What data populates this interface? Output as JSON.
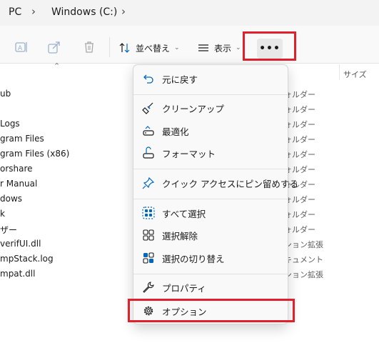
{
  "breadcrumb": {
    "items": [
      "PC",
      "Windows (C:)"
    ]
  },
  "toolbar": {
    "sort_label": "並べ替え",
    "view_label": "表示",
    "more_label": "•••"
  },
  "file_list": {
    "size_header": "サイズ",
    "rows": [
      {
        "name": "ub",
        "type": "ォルダー"
      },
      {
        "name": "",
        "type": "ォルダー"
      },
      {
        "name": "Logs",
        "type": "ォルダー"
      },
      {
        "name": "gram Files",
        "type": "ォルダー"
      },
      {
        "name": "gram Files (x86)",
        "type": "ォルダー"
      },
      {
        "name": "orshare",
        "type": "ォルダー"
      },
      {
        "name": "r Manual",
        "type": "ォルダー"
      },
      {
        "name": "dows",
        "type": "ォルダー"
      },
      {
        "name": "k",
        "type": "ォルダー"
      },
      {
        "name": "ザー",
        "type": "ォルダー"
      },
      {
        "name": "verifUI.dll",
        "type": "ション拡張"
      },
      {
        "name": "mpStack.log",
        "type": "キュメント"
      },
      {
        "name": "mpat.dll",
        "type": "ション拡張"
      }
    ]
  },
  "menu": {
    "undo": "元に戻す",
    "cleanup": "クリーンアップ",
    "optimize": "最適化",
    "format": "フォーマット",
    "pin_quick_access": "クイック アクセスにピン留めする",
    "select_all": "すべて選択",
    "select_none": "選択解除",
    "invert_selection": "選択の切り替え",
    "properties": "プロパティ",
    "options": "オプション"
  },
  "colors": {
    "accent": "#0067c0",
    "highlight_box": "#e0202a"
  }
}
